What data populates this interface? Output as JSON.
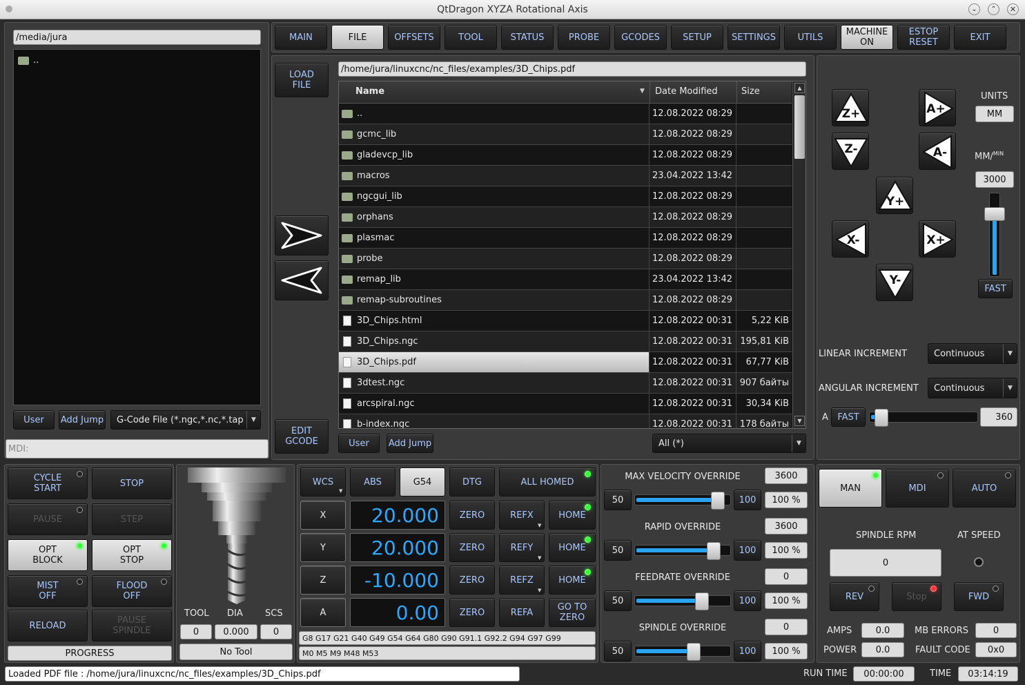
{
  "title": "QtDragon XYZA Rotational Axis",
  "left": {
    "path": "/media/jura",
    "items": [
      ".."
    ],
    "user": "User",
    "add_jump": "Add Jump",
    "filter": "G-Code File (*.ngc,*.nc,*.tap",
    "mdi": "MDI:"
  },
  "tabs": [
    "MAIN",
    "FILE",
    "OFFSETS",
    "TOOL",
    "STATUS",
    "PROBE",
    "GCODES",
    "SETUP",
    "SETTINGS",
    "UTILS"
  ],
  "machine_on": "MACHINE ON",
  "estop": "ESTOP RESET",
  "exit": "EXIT",
  "file": {
    "load": "LOAD FILE",
    "edit": "EDIT GCODE",
    "path": "/home/jura/linuxcnc/nc_files/examples/3D_Chips.pdf",
    "headers": [
      "Name",
      "Date Modified",
      "Size"
    ],
    "rows": [
      {
        "name": "..",
        "date": "12.08.2022 08:29",
        "size": "",
        "type": "folder"
      },
      {
        "name": "gcmc_lib",
        "date": "12.08.2022 08:29",
        "size": "",
        "type": "folder"
      },
      {
        "name": "gladevcp_lib",
        "date": "12.08.2022 08:29",
        "size": "",
        "type": "folder"
      },
      {
        "name": "macros",
        "date": "23.04.2022 13:42",
        "size": "",
        "type": "folder"
      },
      {
        "name": "ngcgui_lib",
        "date": "12.08.2022 08:29",
        "size": "",
        "type": "folder"
      },
      {
        "name": "orphans",
        "date": "12.08.2022 08:29",
        "size": "",
        "type": "folder"
      },
      {
        "name": "plasmac",
        "date": "12.08.2022 08:29",
        "size": "",
        "type": "folder"
      },
      {
        "name": "probe",
        "date": "12.08.2022 08:29",
        "size": "",
        "type": "folder"
      },
      {
        "name": "remap_lib",
        "date": "23.04.2022 13:42",
        "size": "",
        "type": "folder"
      },
      {
        "name": "remap-subroutines",
        "date": "12.08.2022 08:29",
        "size": "",
        "type": "folder"
      },
      {
        "name": "3D_Chips.html",
        "date": "12.08.2022 00:31",
        "size": "5,22 KiB",
        "type": "file"
      },
      {
        "name": "3D_Chips.ngc",
        "date": "12.08.2022 00:31",
        "size": "195,81 KiB",
        "type": "file"
      },
      {
        "name": "3D_Chips.pdf",
        "date": "12.08.2022 00:31",
        "size": "67,77 KiB",
        "type": "file"
      },
      {
        "name": "3dtest.ngc",
        "date": "12.08.2022 00:31",
        "size": "907 байты",
        "type": "file"
      },
      {
        "name": "arcspiral.ngc",
        "date": "12.08.2022 00:31",
        "size": "30,34 KiB",
        "type": "file"
      },
      {
        "name": "b-index.ngc",
        "date": "12.08.2022 00:31",
        "size": "178 байты",
        "type": "file"
      }
    ],
    "user": "User",
    "add_jump": "Add Jump",
    "filter": "All (*)"
  },
  "jog": {
    "units_label": "UNITS",
    "units": "MM",
    "rate_label": "MM/",
    "rate_sup": "MIN",
    "rate": "3000",
    "fast": "FAST",
    "linear_label": "LINEAR INCREMENT",
    "linear": "Continuous",
    "angular_label": "ANGULAR INCREMENT",
    "angular": "Continuous",
    "a_label": "A",
    "a_fast": "FAST",
    "a_rate": "360",
    "a_fraction": 0.05,
    "rate_fraction": 0.8,
    "keys": [
      "Z+",
      "Z-",
      "A+",
      "A-",
      "Y+",
      "Y-",
      "X-",
      "X+"
    ]
  },
  "ctrl": {
    "cycle": "CYCLE START",
    "stop": "STOP",
    "pause": "PAUSE",
    "step": "STEP",
    "optblock": "OPT BLOCK",
    "optstop": "OPT STOP",
    "mist": "MIST OFF",
    "flood": "FLOOD OFF",
    "reload": "RELOAD",
    "pausesp": "PAUSE SPINDLE",
    "progress": "PROGRESS"
  },
  "tool": {
    "h1": "TOOL",
    "h2": "DIA",
    "h3": "SCS",
    "tool": "0",
    "dia": "0.000",
    "scs": "0",
    "name": "No Tool"
  },
  "dro": {
    "wcs": "WCS",
    "abs": "ABS",
    "g54": "G54",
    "dtg": "DTG",
    "homed": "ALL HOMED",
    "axes": [
      {
        "axis": "X",
        "value": "20.000",
        "ref": "REFX",
        "home": "HOME"
      },
      {
        "axis": "Y",
        "value": "20.000",
        "ref": "REFY",
        "home": "HOME"
      },
      {
        "axis": "Z",
        "value": "-10.000",
        "ref": "REFZ",
        "home": "HOME"
      },
      {
        "axis": "A",
        "value": "0.00",
        "ref": "REFA",
        "home": "GO TO ZERO"
      }
    ],
    "zero": "ZERO",
    "gcodes": "G8 G17 G21 G40 G49 G54 G64 G80 G90 G91.1 G92.2 G94 G97 G99",
    "mcodes": "M0 M5 M9 M48 M53"
  },
  "ovr": [
    {
      "label": "MAX VELOCITY OVERRIDE",
      "max": "3600",
      "lo": "50",
      "hi": "100",
      "pct": "100 %",
      "frac": 0.95
    },
    {
      "label": "RAPID OVERRIDE",
      "max": "3600",
      "lo": "50",
      "hi": "100",
      "pct": "100 %",
      "frac": 0.9
    },
    {
      "label": "FEEDRATE OVERRIDE",
      "max": "0",
      "lo": "50",
      "hi": "100",
      "pct": "100 %",
      "frac": 0.75
    },
    {
      "label": "SPINDLE OVERRIDE",
      "max": "0",
      "lo": "50",
      "hi": "100",
      "pct": "100 %",
      "frac": 0.65
    }
  ],
  "spindle": {
    "man": "MAN",
    "mdi": "MDI",
    "auto": "AUTO",
    "rpm_label": "SPINDLE RPM",
    "atspeed": "AT SPEED",
    "rpm": "0",
    "rev": "REV",
    "stop": "Stop",
    "fwd": "FWD",
    "amps_l": "AMPS",
    "amps": "0.0",
    "mberr_l": "MB ERRORS",
    "mberr": "0",
    "power_l": "POWER",
    "power": "0.0",
    "fault_l": "FAULT CODE",
    "fault": "0x0"
  },
  "status": {
    "msg": "Loaded PDF file : /home/jura/linuxcnc/nc_files/examples/3D_Chips.pdf",
    "runtime_l": "RUN TIME",
    "runtime": "00:00:00",
    "time_l": "TIME",
    "time": "03:14:19"
  }
}
